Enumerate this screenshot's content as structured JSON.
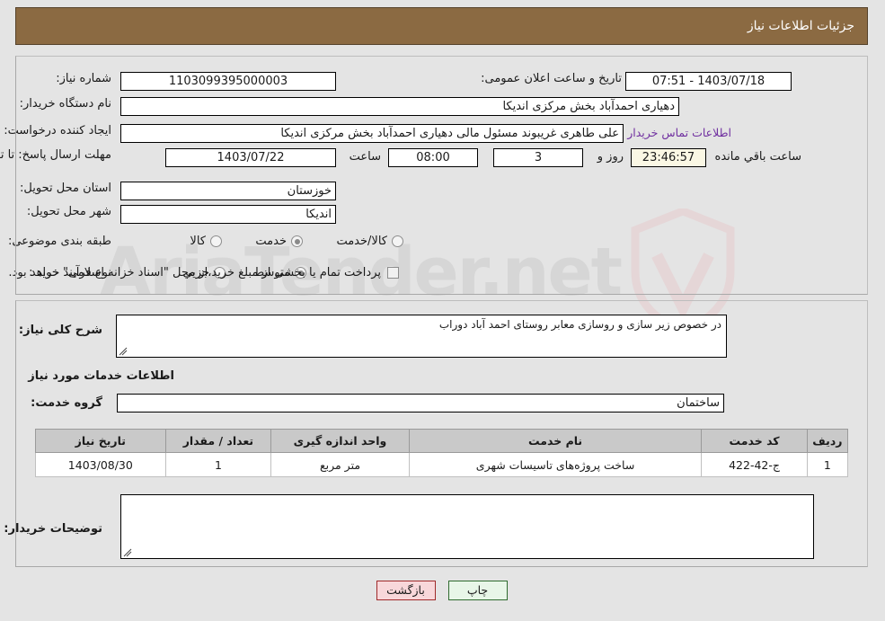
{
  "header": {
    "title": "جزئیات اطلاعات نیاز"
  },
  "colors": {
    "header_bg": "#8b6a42",
    "link": "#7030a0",
    "countdown_bg": "#faf7e4",
    "back_btn_bg": "#f8d7da",
    "print_btn_bg": "#e8f6e8",
    "table_header_bg": "#c9c9c9",
    "page_bg": "#e4e4e4"
  },
  "watermark": {
    "text": "AriaTender.net"
  },
  "top_form": {
    "need_number": {
      "label": "شماره نیاز:",
      "value": "1103099395000003"
    },
    "public_announce": {
      "label": "تاریخ و ساعت اعلان عمومی:",
      "value": "1403/07/18 - 07:51"
    },
    "buyer_org": {
      "label": "نام دستگاه خریدار:",
      "value": "دهیاری احمدآباد بخش مرکزی اندیکا"
    },
    "request_creator": {
      "label": "ایجاد کننده درخواست:",
      "value": "علی طاهری غریبوند مسئول مالی  دهیاری احمدآباد بخش مرکزی اندیکا"
    },
    "buyer_contact_link": "اطلاعات تماس خریدار",
    "deadline": {
      "label": "مهلت ارسال پاسخ: تا تاریخ:",
      "date": "1403/07/22",
      "hour_label": "ساعت",
      "hour": "08:00",
      "days": "3",
      "days_unit_label": "روز و",
      "countdown": "23:46:57",
      "countdown_suffix_label": "ساعت باقي مانده"
    },
    "delivery_province": {
      "label": "استان محل تحویل:",
      "value": "خوزستان"
    },
    "delivery_city": {
      "label": "شهر محل تحویل:",
      "value": "اندیکا"
    },
    "subject_category": {
      "label": "طبقه بندی موضوعی:",
      "options": [
        {
          "label": "کالا",
          "selected": false
        },
        {
          "label": "خدمت",
          "selected": true
        },
        {
          "label": "کالا/خدمت",
          "selected": false
        }
      ]
    },
    "purchase_process": {
      "label": "نوع فرآیند خرید :",
      "options": [
        {
          "label": "جزیي",
          "selected": false
        },
        {
          "label": "متوسط",
          "selected": true
        }
      ],
      "checkbox_checked": false,
      "checkbox_text": "پرداخت تمام یا بخشی از مبلغ خرید،از محل \"اسناد خزانه اسلامی\" خواهد بود."
    }
  },
  "middle": {
    "general_description": {
      "label": "شرح کلی نیاز:",
      "value": "در خصوص زیر سازی و روسازی معابر روستای احمد آباد دوراب"
    },
    "services_section_title": "اطلاعات خدمات مورد نیاز",
    "service_group": {
      "label": "گروه خدمت:",
      "value": "ساختمان"
    },
    "table": {
      "columns": [
        "ردیف",
        "کد خدمت",
        "نام خدمت",
        "واحد اندازه گیری",
        "تعداد / مقدار",
        "تاریخ نیاز"
      ],
      "rows": [
        {
          "row_no": "1",
          "service_code": "ج-42-422",
          "service_name": "ساخت پروژه‌های تاسیسات شهری",
          "unit": "متر مربع",
          "quantity": "1",
          "need_date": "1403/08/30"
        }
      ]
    },
    "buyer_notes": {
      "label": "توضیحات خریدار:",
      "value": ""
    }
  },
  "footer": {
    "back_button": "بازگشت",
    "print_button": "چاپ"
  }
}
